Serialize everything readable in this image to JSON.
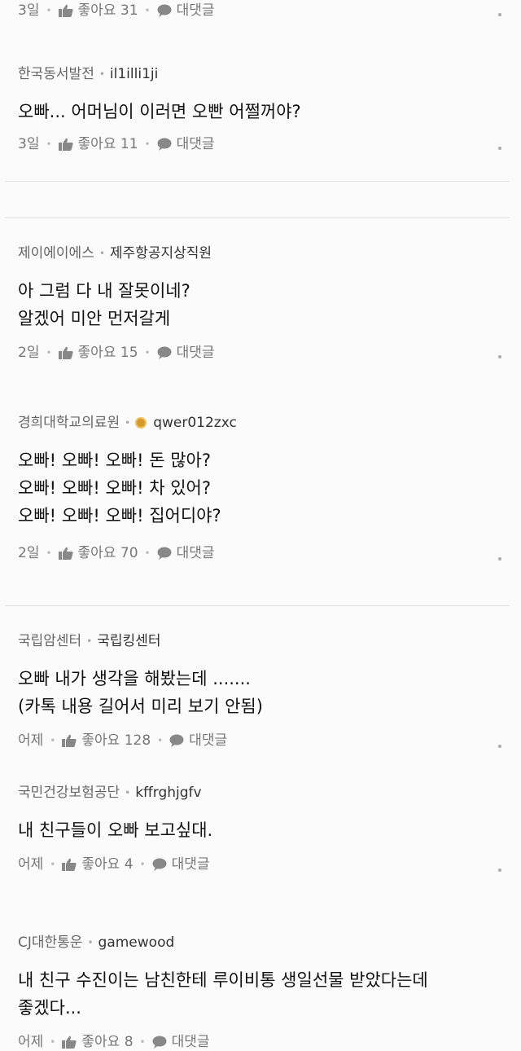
{
  "labels": {
    "like": "좋아요",
    "reply": "대댓글"
  },
  "comments": [
    {
      "time": "3일",
      "likes": "31"
    },
    {
      "org": "한국동서발전",
      "user": "il1illi1ji",
      "lines": [
        "오빠... 어머님이 이러면 오빤 어쩔꺼야?"
      ],
      "time": "3일",
      "likes": "11"
    },
    {
      "org": "제이에이에스",
      "user": "제주항공지상직원",
      "lines": [
        "아 그럼 다 내 잘못이네?",
        "알겠어 미안 먼저갈게"
      ],
      "time": "2일",
      "likes": "15"
    },
    {
      "org": "경희대학교의료원",
      "user": "qwer012zxc",
      "lines": [
        "오빠! 오빠! 오빠! 돈 많아?",
        "오빠! 오빠! 오빠! 차 있어?",
        "오빠! 오빠! 오빠! 집어디야?"
      ],
      "time": "2일",
      "likes": "70"
    },
    {
      "org": "국립암센터",
      "user": "국립킹센터",
      "lines": [
        "오빠 내가 생각을 해봤는데 .......",
        "(카톡 내용 길어서 미리 보기 안됨)"
      ],
      "time": "어제",
      "likes": "128"
    },
    {
      "org": "국민건강보험공단",
      "user": "kffrghjgfv",
      "lines": [
        "내 친구들이 오빠 보고싶대."
      ],
      "time": "어제",
      "likes": "4"
    },
    {
      "org": "CJ대한통운",
      "user": "gamewood",
      "lines": [
        "내 친구 수진이는 남친한테 루이비통 생일선물 받았다는데",
        "좋겠다..."
      ],
      "time": "어제",
      "likes": "8"
    }
  ]
}
